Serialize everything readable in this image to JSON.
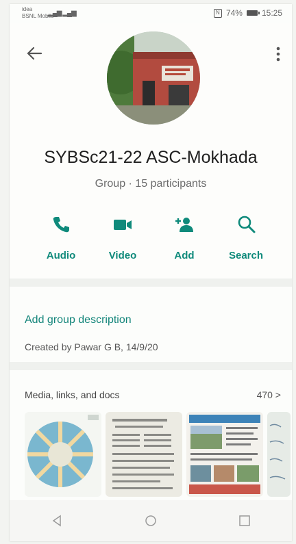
{
  "status_bar": {
    "carrier": "idea\nBSNL Mobile",
    "battery_percent": "74%",
    "time": "15:25"
  },
  "header": {
    "back_icon": "arrow-left-icon",
    "more_icon": "vertical-dots-icon",
    "group_name": "SYBSc21-22 ASC-Mokhada",
    "group_subtitle": "Group · 15 participants"
  },
  "actions": [
    {
      "label": "Audio",
      "icon": "phone-icon"
    },
    {
      "label": "Video",
      "icon": "video-camera-icon"
    },
    {
      "label": "Add",
      "icon": "add-person-icon"
    },
    {
      "label": "Search",
      "icon": "search-icon"
    }
  ],
  "description": {
    "add_label": "Add group description",
    "created_text": "Created by Pawar G B, 14/9/20"
  },
  "media": {
    "title": "Media, links, and docs",
    "count": "470 >"
  },
  "colors": {
    "accent": "#0f8a7b",
    "background": "#fcfdfb"
  }
}
